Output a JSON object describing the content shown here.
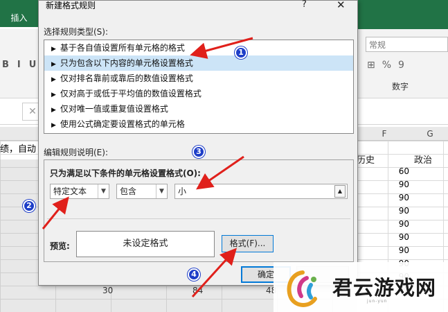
{
  "excel": {
    "tab_insert": "插入",
    "format_buttons": [
      "B",
      "I",
      "U"
    ],
    "number_format": "常规",
    "number_group_label": "数字",
    "number_icons": [
      "%",
      "9"
    ],
    "formula_cancel": "✕",
    "cell_text": "绩，自动",
    "col_f": "F",
    "col_g": "G",
    "header_history": "历史",
    "header_politics": "政治",
    "scores": [
      "60",
      "90",
      "90",
      "90",
      "90",
      "90",
      "90",
      "90",
      "90",
      "90"
    ],
    "bottom_nums": [
      "30",
      "84",
      "48"
    ]
  },
  "dialog": {
    "title": "新建格式规则",
    "help": "?",
    "close": "✕",
    "select_rule_label": "选择规则类型(S):",
    "rules": [
      "基于各自值设置所有单元格的格式",
      "只为包含以下内容的单元格设置格式",
      "仅对排名靠前或靠后的数值设置格式",
      "仅对高于或低于平均值的数值设置格式",
      "仅对唯一值或重复值设置格式",
      "使用公式确定要设置格式的单元格"
    ],
    "edit_rule_label": "编辑规则说明(E):",
    "only_format_label": "只为满足以下条件的单元格设置格式(O):",
    "condition_type": "特定文本",
    "operator": "包含",
    "value": "小",
    "preview_label": "预览:",
    "preview_text": "未设定格式",
    "format_button": "格式(F)...",
    "ok_button": "确定",
    "cancel_button": ""
  },
  "annotations": {
    "badges": [
      "1",
      "2",
      "3",
      "4"
    ],
    "color": "#1e3ec8",
    "arrow_color": "#e0201b"
  },
  "watermark": {
    "text": "君云游戏网",
    "sub": "jun-yun"
  }
}
